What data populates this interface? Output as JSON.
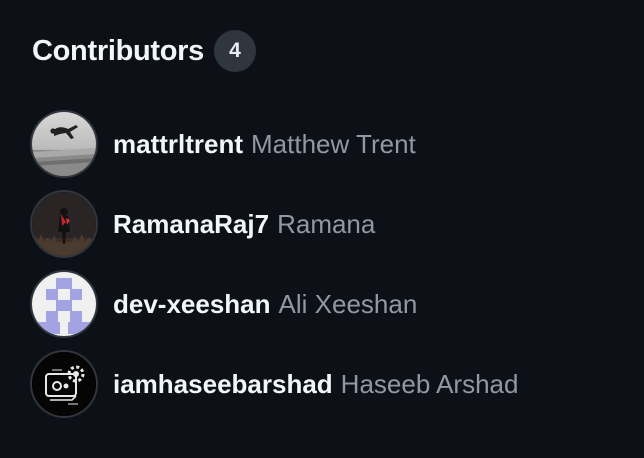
{
  "section": {
    "title": "Contributors",
    "count": "4"
  },
  "contributors": [
    {
      "login": "mattrltrent",
      "name": "Matthew Trent",
      "avatar": "silhouette-jump-photo"
    },
    {
      "login": "RamanaRaj7",
      "name": "Ramana",
      "avatar": "dark-figure-photo"
    },
    {
      "login": "dev-xeeshan",
      "name": "Ali Xeeshan",
      "avatar": "identicon-purple"
    },
    {
      "login": "iamhaseebarshad",
      "name": "Haseeb Arshad",
      "avatar": "gear-icon-logo"
    }
  ],
  "colors": {
    "background": "#0d1117",
    "text_primary": "#f0f6fc",
    "text_muted": "#9198a1",
    "badge_bg": "#30363d",
    "identicon": "#a0a0e0"
  }
}
